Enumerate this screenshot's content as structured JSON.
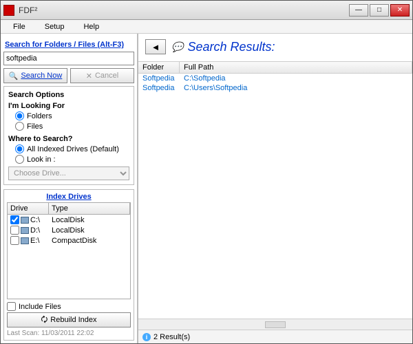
{
  "window": {
    "title": "FDF²"
  },
  "menubar": {
    "file": "File",
    "setup": "Setup",
    "help": "Help"
  },
  "search": {
    "title": "Search for Folders / Files (Alt-F3)",
    "query": "softpedia",
    "search_btn": "Search Now",
    "cancel_btn": "Cancel",
    "options_title": "Search Options",
    "looking_for": {
      "title": "I'm Looking For",
      "folders": "Folders",
      "files": "Files",
      "selected": "folders"
    },
    "where": {
      "title": "Where to Search?",
      "all": "All Indexed Drives (Default)",
      "lookin": "Look in :",
      "selected": "all",
      "drive_placeholder": "Choose Drive..."
    }
  },
  "index": {
    "title": "Index Drives",
    "columns": {
      "drive": "Drive",
      "type": "Type"
    },
    "rows": [
      {
        "checked": true,
        "label": "C:\\",
        "type": "LocalDisk"
      },
      {
        "checked": false,
        "label": "D:\\",
        "type": "LocalDisk"
      },
      {
        "checked": false,
        "label": "E:\\",
        "type": "CompactDisk"
      }
    ],
    "include_files": "Include Files",
    "rebuild": "Rebuild Index",
    "last_scan": "Last Scan: 11/03/2011 22:02"
  },
  "results": {
    "title": "Search Results:",
    "columns": {
      "folder": "Folder",
      "path": "Full Path"
    },
    "rows": [
      {
        "folder": "Softpedia",
        "path": "C:\\Softpedia"
      },
      {
        "folder": "Softpedia",
        "path": "C:\\Users\\Softpedia"
      }
    ],
    "status": "2 Result(s)"
  }
}
